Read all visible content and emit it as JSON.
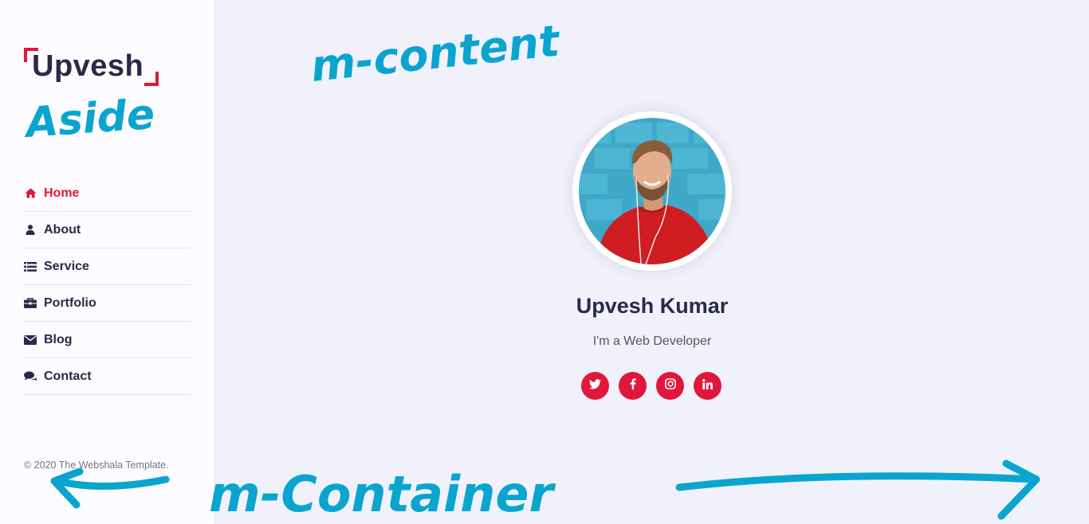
{
  "sidebar": {
    "logo_text": "Upvesh",
    "nav": [
      {
        "label": "Home",
        "icon": "home-icon",
        "active": true
      },
      {
        "label": "About",
        "icon": "user-icon",
        "active": false
      },
      {
        "label": "Service",
        "icon": "list-icon",
        "active": false
      },
      {
        "label": "Portfolio",
        "icon": "briefcase-icon",
        "active": false
      },
      {
        "label": "Blog",
        "icon": "envelope-icon",
        "active": false
      },
      {
        "label": "Contact",
        "icon": "comments-icon",
        "active": false
      }
    ],
    "copyright": "© 2020 The Webshala Template."
  },
  "main": {
    "name": "Upvesh Kumar",
    "role": "I'm a Web Developer",
    "socials": [
      "twitter-icon",
      "facebook-icon",
      "instagram-icon",
      "linkedin-icon"
    ]
  },
  "annotations": {
    "content_label": "m-content",
    "aside_label": "Aside",
    "container_label": "m-Container"
  },
  "colors": {
    "accent": "#e0173a",
    "text_dark": "#2b2948",
    "background": "#f0f1fb",
    "sidebar_bg": "#fcfbff",
    "annotation": "#0aa5cf"
  }
}
